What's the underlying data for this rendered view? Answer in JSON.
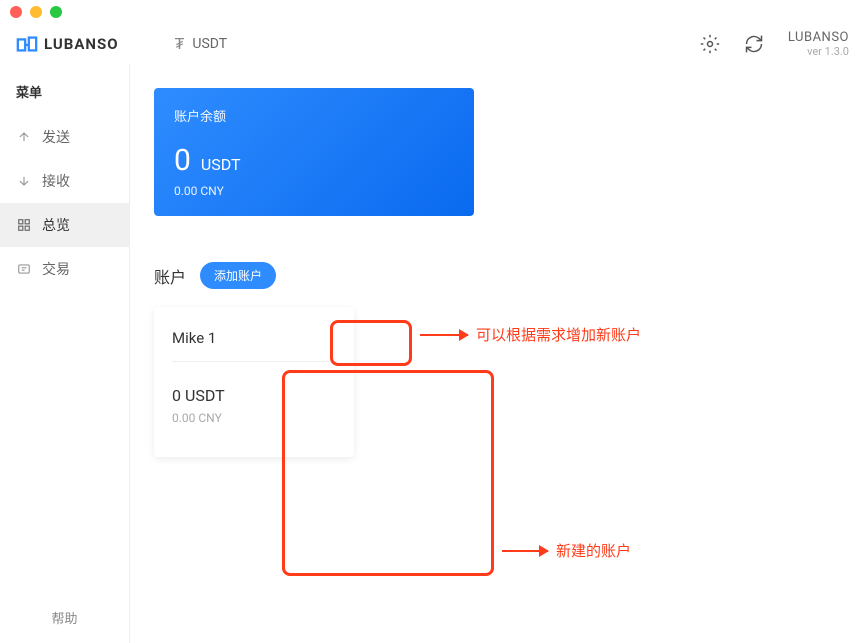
{
  "header": {
    "logo_text": "LUBANSO",
    "currency_symbol": "₮",
    "currency_label": "USDT",
    "brand_name": "LUBANSO",
    "version": "ver 1.3.0"
  },
  "sidebar": {
    "menu_title": "菜单",
    "items": [
      {
        "label": "发送",
        "icon": "send"
      },
      {
        "label": "接收",
        "icon": "receive"
      },
      {
        "label": "总览",
        "icon": "overview"
      },
      {
        "label": "交易",
        "icon": "transactions"
      }
    ],
    "help_label": "帮助"
  },
  "balance": {
    "label": "账户余额",
    "amount": "0",
    "unit": "USDT",
    "sub": "0.00 CNY"
  },
  "accounts": {
    "title": "账户",
    "add_button": "添加账户",
    "items": [
      {
        "name": "Mike 1",
        "balance": "0 USDT",
        "sub": "0.00 CNY"
      }
    ]
  },
  "annotations": {
    "add_hint": "可以根据需求增加新账户",
    "new_account_hint": "新建的账户"
  }
}
